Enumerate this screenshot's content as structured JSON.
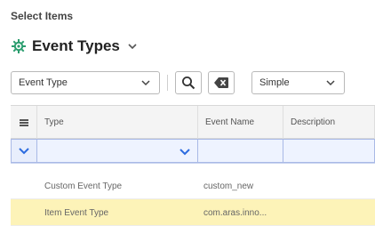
{
  "heading": "Select Items",
  "title": "Event Types",
  "toolbar": {
    "type_select_value": "Event Type",
    "mode_select_value": "Simple"
  },
  "grid": {
    "columns": [
      "Type",
      "Event Name",
      "Description"
    ],
    "rows": [
      {
        "type": "Custom Event Type",
        "event_name": "custom_new",
        "description": ""
      },
      {
        "type": "Item Event Type",
        "event_name": "com.aras.inno...",
        "description": ""
      }
    ]
  },
  "icons": {
    "title": "gear-network-icon",
    "title_chevron": "chevron-down-icon",
    "search": "search-icon",
    "clear": "clear-icon",
    "row_header": "grid-icon",
    "filter_chevrons": "chevron-down-icon"
  },
  "colors": {
    "accent_blue": "#2d6cdf",
    "selected_row": "#fdf3b8",
    "filter_row": "#e8eefc",
    "title_icon_green": "#2a9d6e"
  }
}
